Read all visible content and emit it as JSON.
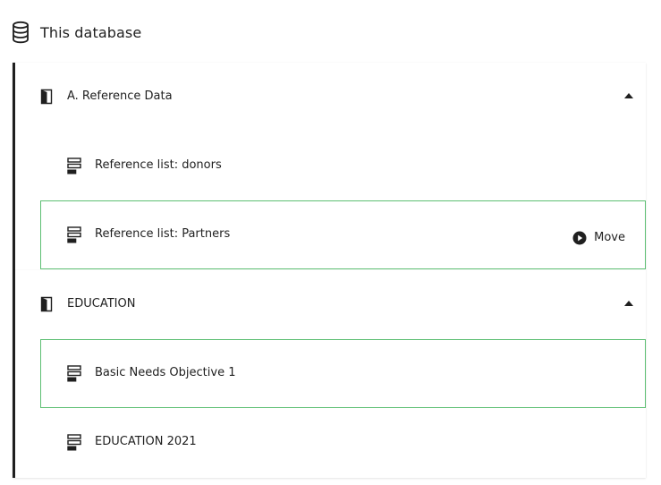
{
  "section": {
    "title": "This database",
    "icon": "database-icon"
  },
  "folders": [
    {
      "label": "A. Reference Data",
      "icon": "book-icon",
      "expanded": true,
      "items": [
        {
          "label": "Reference list: donors",
          "icon": "form-icon",
          "selected": false
        },
        {
          "label": "Reference list: Partners",
          "icon": "form-icon",
          "selected": true,
          "action": "Move"
        }
      ]
    },
    {
      "label": "EDUCATION",
      "icon": "book-icon",
      "expanded": true,
      "items": [
        {
          "label": "Basic Needs Objective 1",
          "icon": "form-icon",
          "selected": true
        },
        {
          "label": "EDUCATION 2021",
          "icon": "form-icon",
          "selected": false
        }
      ]
    }
  ],
  "colors": {
    "accent_border": "#5dbf73",
    "text": "#1f1f1f",
    "folder_bar": "#1f1f1f"
  }
}
